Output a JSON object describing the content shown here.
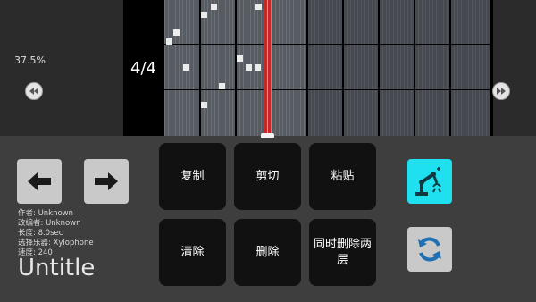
{
  "colors": {
    "background": "#3e3e3e",
    "accent_cyan": "#1fe0ef",
    "playhead_red": "#c62828",
    "button_gray": "#c9c9c9",
    "op_button": "#111111"
  },
  "top_bar": {
    "zoom": "37.5%",
    "time_signature": "4/4",
    "add_label": "+",
    "rewind_icon": "rewind-icon",
    "fast_forward_icon": "fast-forward-icon"
  },
  "song_info": {
    "author": "作者: Unknown",
    "adapter": "改编者: Unknown",
    "length": "长度: 8.0sec",
    "instrument": "选择乐器: Xylophone",
    "speed": "速度: 240",
    "title": "Untitle"
  },
  "actions": {
    "copy": "复制",
    "cut": "剪切",
    "paste": "粘贴",
    "clear": "清除",
    "delete": "删除",
    "delete_both_layers": "同时删除两层"
  }
}
